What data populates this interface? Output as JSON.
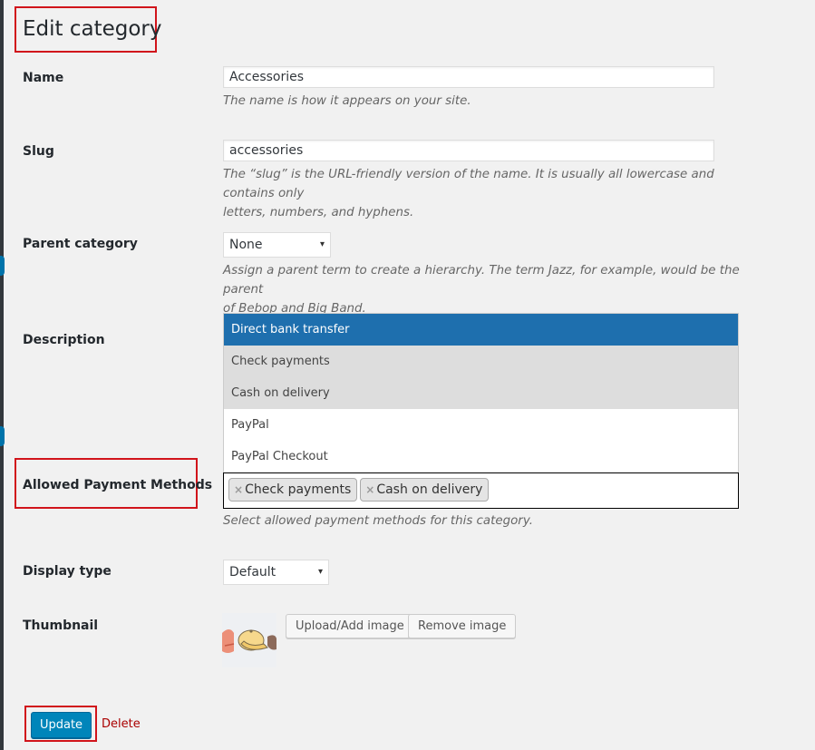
{
  "page": {
    "title": "Edit category"
  },
  "fields": {
    "name": {
      "label": "Name",
      "value": "Accessories",
      "description": "The name is how it appears on your site."
    },
    "slug": {
      "label": "Slug",
      "value": "accessories",
      "description_line1": "The “slug” is the URL-friendly version of the name. It is usually all lowercase and contains only",
      "description_line2": "letters, numbers, and hyphens."
    },
    "parent": {
      "label": "Parent category",
      "value": "None",
      "description_line1": "Assign a parent term to create a hierarchy. The term Jazz, for example, would be the parent",
      "description_line2": "of Bebop and Big Band."
    },
    "description": {
      "label": "Description"
    },
    "payment": {
      "label": "Allowed Payment Methods",
      "options": [
        "Direct bank transfer",
        "Check payments",
        "Cash on delivery",
        "PayPal",
        "PayPal Checkout"
      ],
      "selected": [
        "Check payments",
        "Cash on delivery"
      ],
      "remove_glyph": "×",
      "description": "Select allowed payment methods for this category."
    },
    "display_type": {
      "label": "Display type",
      "value": "Default"
    },
    "thumbnail": {
      "label": "Thumbnail",
      "upload_label": "Upload/Add image",
      "remove_label": "Remove image"
    }
  },
  "actions": {
    "update_label": "Update",
    "delete_label": "Delete"
  },
  "icons": {
    "select_arrow": "▾"
  },
  "colors": {
    "primary": "#0085ba",
    "highlight": "#1e6fae",
    "danger": "#aa0000",
    "annotation": "#d1141b"
  }
}
